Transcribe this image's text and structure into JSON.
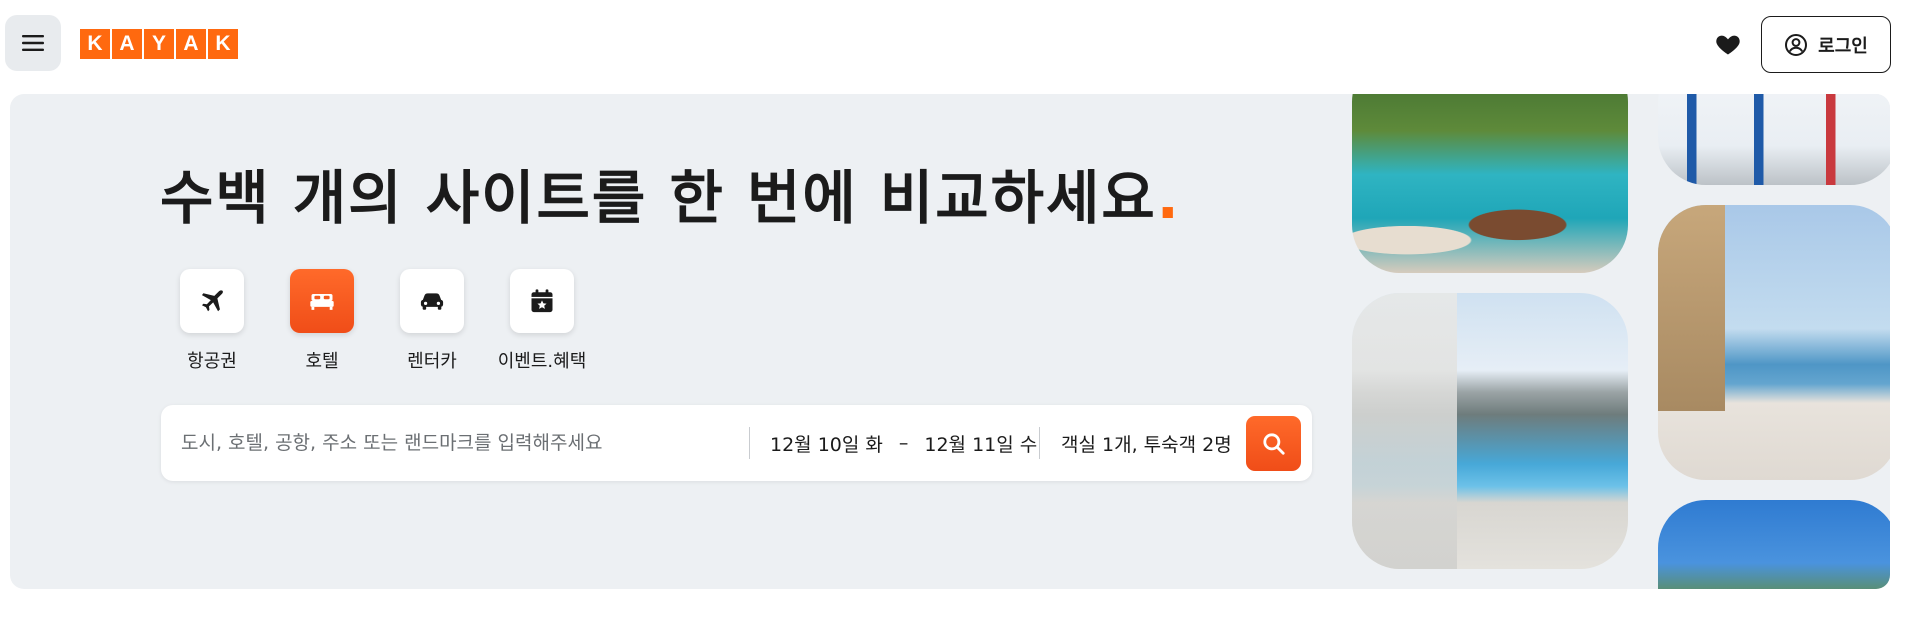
{
  "header": {
    "menu_icon": "hamburger-menu-icon",
    "logo_letters": [
      "K",
      "A",
      "Y",
      "A",
      "K"
    ],
    "logo_color": "#ff690f",
    "favorites_icon": "heart-icon",
    "login_label": "로그인",
    "login_icon": "user-circle-icon"
  },
  "hero": {
    "headline": "수백 개의 사이트를 한 번에 비교하세요",
    "headline_dot": ".",
    "accent_color": "#ff690f",
    "tabs": [
      {
        "label": "항공권",
        "icon": "airplane-icon",
        "active": false
      },
      {
        "label": "호텔",
        "icon": "bed-icon",
        "active": true
      },
      {
        "label": "렌터카",
        "icon": "car-icon",
        "active": false
      },
      {
        "label": "이벤트.혜택",
        "icon": "calendar-star-icon",
        "active": false
      }
    ],
    "search": {
      "placeholder": "도시, 호텔, 공항, 주소 또는 랜드마크를 입력해주세요",
      "checkin": "12월 10일 화",
      "date_separator": "–",
      "checkout": "12월 11일 수",
      "guests": "객실 1개, 투숙객 2명",
      "search_icon": "search-icon"
    }
  }
}
